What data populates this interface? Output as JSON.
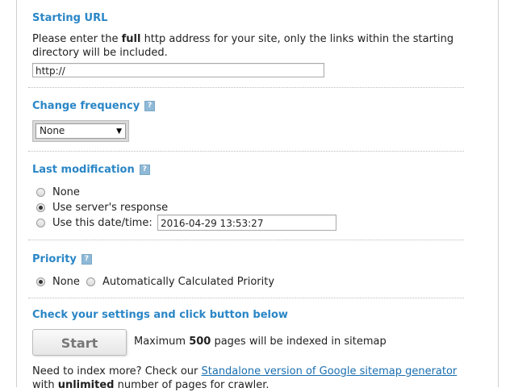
{
  "starting_url": {
    "heading": "Starting URL",
    "desc_pre": "Please enter the ",
    "desc_bold": "full",
    "desc_line1_post": " http address for your site, only the links within the starting",
    "desc_line2": "directory will be included.",
    "input_value": "http://"
  },
  "change_frequency": {
    "heading": "Change frequency",
    "help_glyph": "?",
    "selected": "None"
  },
  "last_modification": {
    "heading": "Last modification",
    "help_glyph": "?",
    "options": [
      "None",
      "Use server's response",
      "Use this date/time:"
    ],
    "selected_index": 1,
    "datetime_value": "2016-04-29 13:53:27"
  },
  "priority": {
    "heading": "Priority",
    "help_glyph": "?",
    "options": [
      "None",
      "Automatically Calculated Priority"
    ],
    "selected_index": 0
  },
  "check": {
    "heading": "Check your settings and click button below",
    "start_label": "Start",
    "max_pre": "Maximum ",
    "max_bold": "500",
    "max_post": " pages will be indexed in sitemap"
  },
  "more": {
    "line1_pre": "Need to index more? Check our ",
    "line1_link": "Standalone version of Google sitemap generator",
    "line2_pre": "with ",
    "line2_bold": "unlimited",
    "line2_post": " number of pages for crawler."
  }
}
